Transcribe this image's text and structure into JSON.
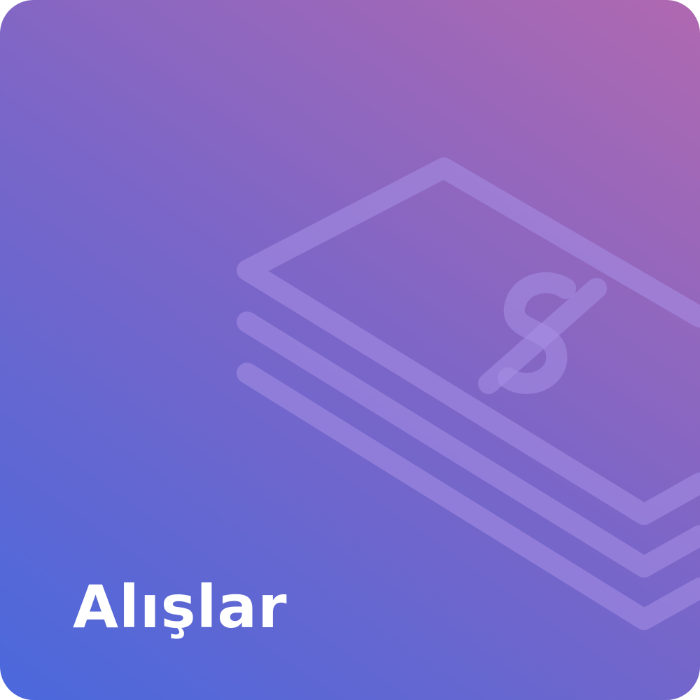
{
  "tile": {
    "title": "Alışlar",
    "icon": "money-stack-icon",
    "gradient_start": "#4a68dc",
    "gradient_end": "#b068b0"
  }
}
